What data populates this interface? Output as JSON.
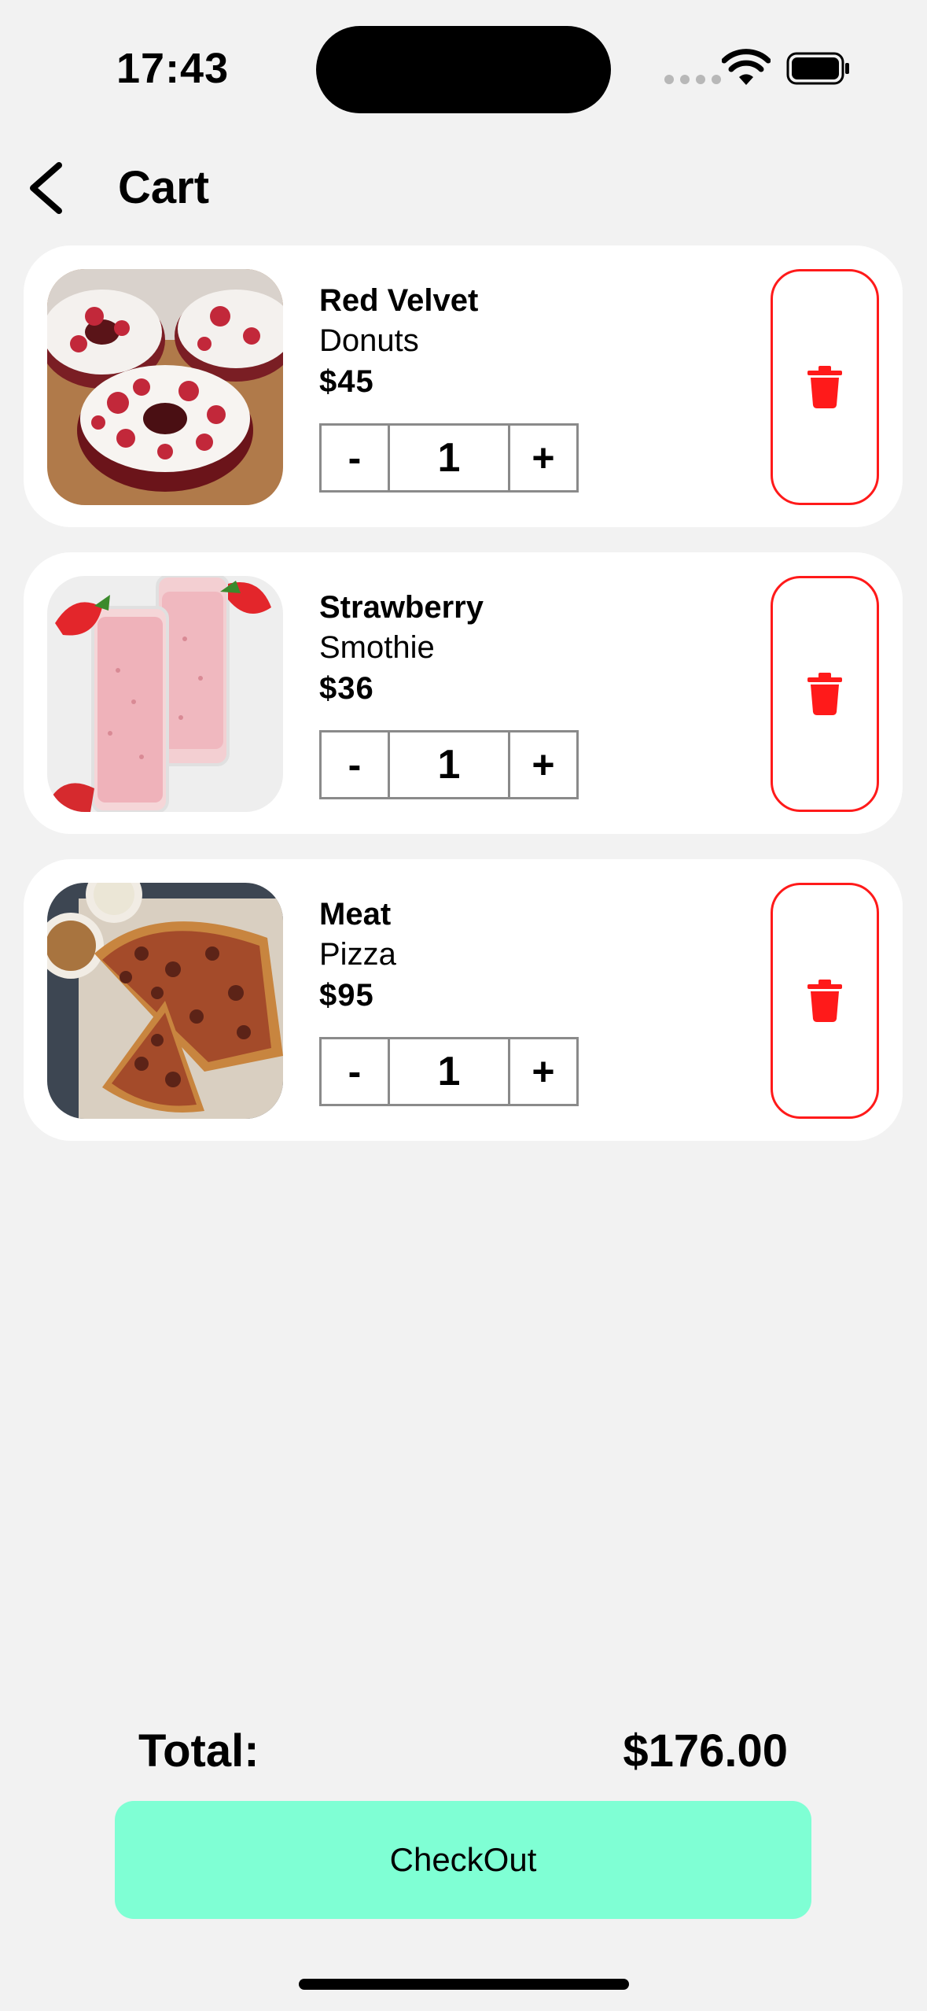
{
  "status_bar": {
    "time": "17:43"
  },
  "header": {
    "title": "Cart"
  },
  "items": [
    {
      "name": "Red Velvet",
      "desc": "Donuts",
      "price": "$45",
      "quantity": "1",
      "minus": "-",
      "plus": "+"
    },
    {
      "name": "Strawberry",
      "desc": "Smothie",
      "price": "$36",
      "quantity": "1",
      "minus": "-",
      "plus": "+"
    },
    {
      "name": "Meat",
      "desc": "Pizza",
      "price": "$95",
      "quantity": "1",
      "minus": "-",
      "plus": "+"
    }
  ],
  "summary": {
    "total_label": "Total:",
    "total_value": "$176.00"
  },
  "checkout": {
    "label": "CheckOut"
  },
  "colors": {
    "background": "#f2f2f2",
    "checkout_button": "#7fffd4",
    "delete_accent": "#ff1a1a",
    "card": "#ffffff"
  }
}
